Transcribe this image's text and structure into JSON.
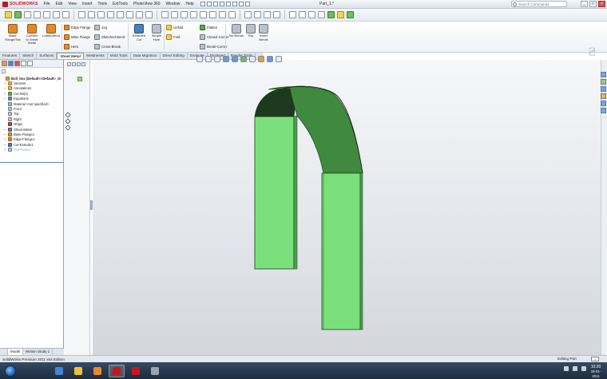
{
  "app": {
    "logo_text": "SOLIDWORKS",
    "document_title": "Part_1.*",
    "menus": [
      "File",
      "Edit",
      "View",
      "Insert",
      "Tools",
      "ExtTools",
      "PhotoView 360",
      "Window",
      "Help"
    ],
    "search_placeholder": "Search Commands"
  },
  "ribbon": {
    "big_buttons": [
      {
        "label": "Base\nFlange/Tab",
        "icon": "base-flange-icon"
      },
      {
        "label": "Convert\nto Sheet\nMetal",
        "icon": "convert-sheet-metal-icon"
      },
      {
        "label": "Lofted-Bend",
        "icon": "lofted-bend-icon"
      },
      {
        "label": "Extruded\nCut",
        "icon": "extruded-cut-icon"
      },
      {
        "label": "Simple\nHole",
        "icon": "simple-hole-icon"
      },
      {
        "label": "No Bends",
        "icon": "no-bends-icon"
      },
      {
        "label": "Rip",
        "icon": "rip-icon"
      },
      {
        "label": "Insert\nBends",
        "icon": "insert-bends-icon"
      }
    ],
    "small_buttons": [
      {
        "label": "Edge Flange",
        "icon": "edge-flange-icon"
      },
      {
        "label": "Miter Flange",
        "icon": "miter-flange-icon"
      },
      {
        "label": "Hem",
        "icon": "hem-icon"
      },
      {
        "label": "Jog",
        "icon": "jog-icon"
      },
      {
        "label": "Sketched Bend",
        "icon": "sketched-bend-icon"
      },
      {
        "label": "Cross-Break",
        "icon": "cross-break-icon"
      },
      {
        "label": "Unfold",
        "icon": "unfold-icon"
      },
      {
        "label": "Fold",
        "icon": "fold-icon"
      },
      {
        "label": "Flatten",
        "icon": "flatten-icon"
      },
      {
        "label": "Closed Corner",
        "icon": "closed-corner-icon"
      },
      {
        "label": "Break-Corner",
        "icon": "break-corner-icon"
      }
    ]
  },
  "tabs": [
    "Features",
    "Sketch",
    "Surfaces",
    "Sheet Metal",
    "Weldments",
    "Mold Tools",
    "Data Migration",
    "Direct Editing",
    "Evaluate",
    "DimXpert",
    "Render Tools"
  ],
  "active_tab": "Sheet Metal",
  "tree": [
    {
      "label": "Bull_box (Default<<Default>_Di",
      "icon": "part-icon",
      "color": "#d6a33a",
      "level": 0,
      "expander": ""
    },
    {
      "label": "Sensors",
      "icon": "sensors-folder-icon",
      "color": "#e2b64f",
      "level": 1,
      "expander": "+"
    },
    {
      "label": "Annotations",
      "icon": "annotations-icon",
      "color": "#e2b64f",
      "level": 1,
      "expander": "+"
    },
    {
      "label": "Cut list(2)",
      "icon": "cut-list-icon",
      "color": "#6fa35a",
      "level": 1,
      "expander": "+"
    },
    {
      "label": "Equations",
      "icon": "equations-icon",
      "color": "#6b8fcf",
      "level": 1,
      "expander": "+"
    },
    {
      "label": "Material <not specified>",
      "icon": "material-icon",
      "color": "#a7b6c7",
      "level": 1,
      "expander": ""
    },
    {
      "label": "Front",
      "icon": "plane-icon",
      "color": "#b7c3d1",
      "level": 1,
      "expander": ""
    },
    {
      "label": "Top",
      "icon": "plane-icon",
      "color": "#b7c3d1",
      "level": 1,
      "expander": ""
    },
    {
      "label": "Right",
      "icon": "plane-icon",
      "color": "#b7c3d1",
      "level": 1,
      "expander": ""
    },
    {
      "label": "Origin",
      "icon": "origin-icon",
      "color": "#c24545",
      "level": 1,
      "expander": ""
    },
    {
      "label": "Sheet-Metal",
      "icon": "sheet-metal-icon",
      "color": "#6d7f9c",
      "level": 1,
      "expander": "+"
    },
    {
      "label": "Base-Flange1",
      "icon": "base-flange-feature-icon",
      "color": "#e08a2c",
      "level": 1,
      "expander": "+"
    },
    {
      "label": "Edge-Flange1",
      "icon": "edge-flange-feature-icon",
      "color": "#e08a2c",
      "level": 1,
      "expander": "+"
    },
    {
      "label": "Cut-Extrude1",
      "icon": "cut-extrude-feature-icon",
      "color": "#4a7fc0",
      "level": 1,
      "expander": "+"
    },
    {
      "label": "Flat-Pattern",
      "icon": "flat-pattern-icon",
      "color": "#b8bfc8",
      "level": 1,
      "expander": "+",
      "dim": true
    }
  ],
  "left_bottom_tabs": [
    "",
    "Model",
    "Motion Study 1"
  ],
  "status": {
    "text": "SolidWorks Premium 2011 x64 Edition",
    "units": "Editing Part",
    "help": "?"
  },
  "taskbar": {
    "time": "10:20",
    "date": "18-01-2011",
    "apps": [
      {
        "name": "ie-icon",
        "color": "#3e86d4"
      },
      {
        "name": "explorer-icon",
        "color": "#f1c13d"
      },
      {
        "name": "media-player-icon",
        "color": "#e58a2a"
      },
      {
        "name": "solidworks-app-icon",
        "color": "#c8161d"
      },
      {
        "name": "app-icon-5",
        "color": "#c8161d"
      },
      {
        "name": "app-icon-6",
        "color": "#9aa4ae"
      }
    ]
  },
  "model": {
    "face_color": "#7be07b",
    "dark_face_color": "#3f8a3f",
    "edge_color": "#1b3d1b"
  }
}
